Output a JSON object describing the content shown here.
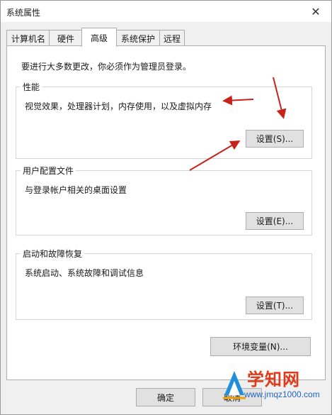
{
  "window": {
    "title": "系统属性",
    "close_glyph": "✕"
  },
  "tabs": [
    {
      "label": "计算机名",
      "active": false
    },
    {
      "label": "硬件",
      "active": false
    },
    {
      "label": "高级",
      "active": true
    },
    {
      "label": "系统保护",
      "active": false
    },
    {
      "label": "远程",
      "active": false
    }
  ],
  "notice": "要进行大多数更改，你必须作为管理员登录。",
  "performance": {
    "title": "性能",
    "desc": "视觉效果，处理器计划，内存使用，以及虚拟内存",
    "button": "设置(S)..."
  },
  "user_profiles": {
    "title": "用户配置文件",
    "desc": "与登录帐户相关的桌面设置",
    "button": "设置(E)..."
  },
  "startup_recovery": {
    "title": "启动和故障恢复",
    "desc": "系统启动、系统故障和调试信息",
    "button": "设置(T)..."
  },
  "env_vars_button": "环境变量(N)...",
  "footer": {
    "ok": "确定",
    "cancel": "取消"
  },
  "watermark": {
    "brand": "学知网",
    "url": "www.jmqz1000.com"
  },
  "annotation_color": "#c8231b"
}
